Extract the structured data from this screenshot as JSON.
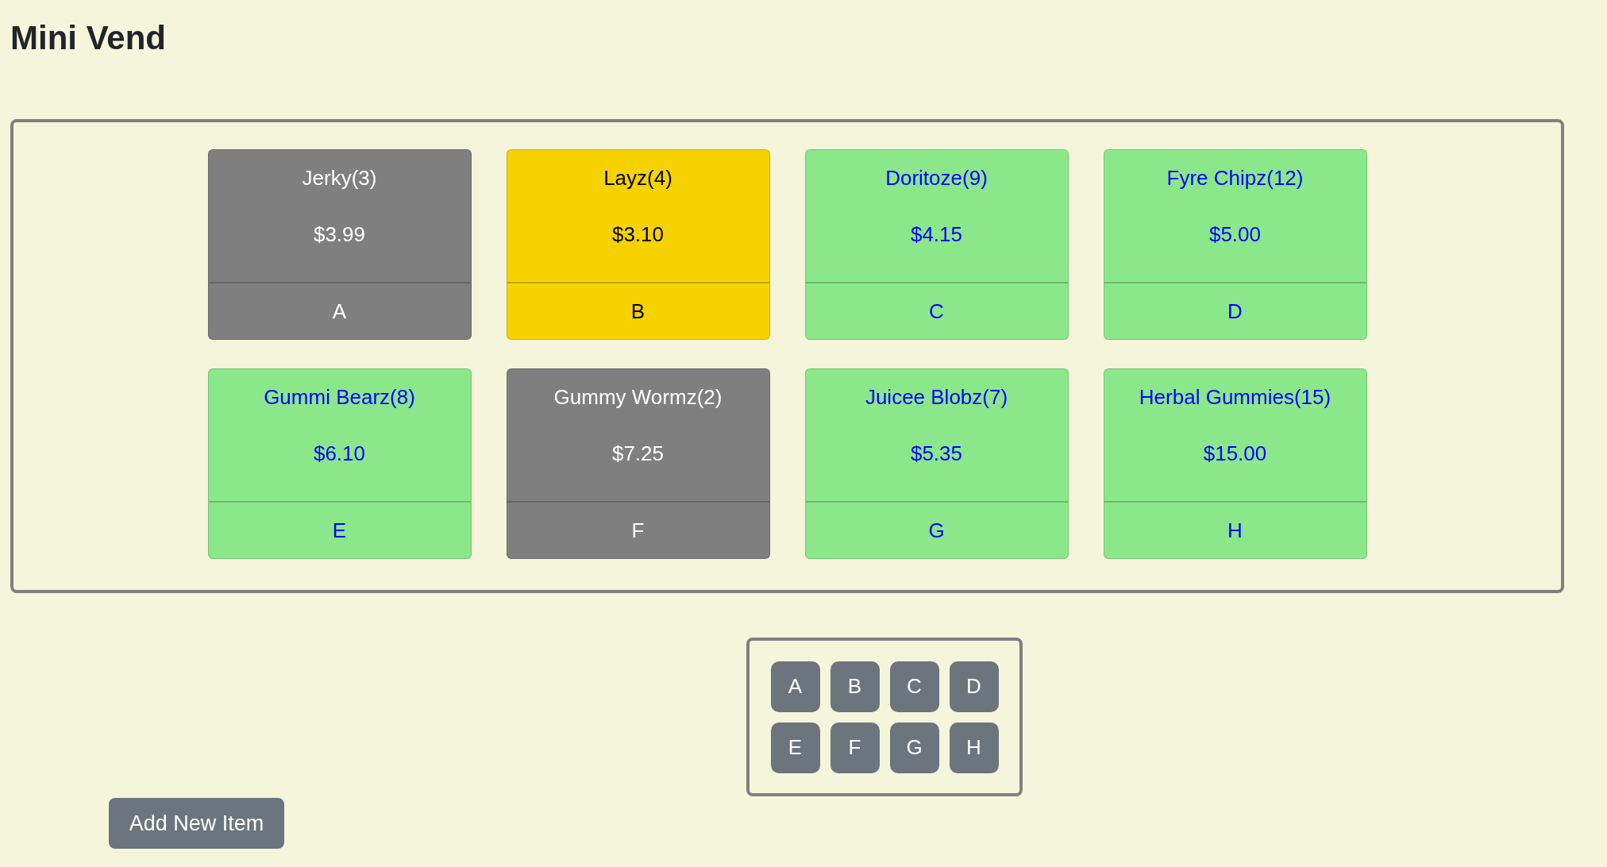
{
  "title": "Mini Vend",
  "items": [
    {
      "name": "Jerky(3)",
      "price": "$3.99",
      "slot": "A",
      "color": "#7f7f7f"
    },
    {
      "name": "Layz(4)",
      "price": "$3.10",
      "slot": "B",
      "color": "#f6d200"
    },
    {
      "name": "Doritoze(9)",
      "price": "$4.15",
      "slot": "C",
      "color": "#8ae88a"
    },
    {
      "name": "Fyre Chipz(12)",
      "price": "$5.00",
      "slot": "D",
      "color": "#8ae88a"
    },
    {
      "name": "Gummi Bearz(8)",
      "price": "$6.10",
      "slot": "E",
      "color": "#8ae88a"
    },
    {
      "name": "Gummy Wormz(2)",
      "price": "$7.25",
      "slot": "F",
      "color": "#7f7f7f"
    },
    {
      "name": "Juicee Blobz(7)",
      "price": "$5.35",
      "slot": "G",
      "color": "#8ae88a"
    },
    {
      "name": "Herbal Gummies(15)",
      "price": "$15.00",
      "slot": "H",
      "color": "#8ae88a"
    }
  ],
  "keypad": [
    "A",
    "B",
    "C",
    "D",
    "E",
    "F",
    "G",
    "H"
  ],
  "add_button": "Add New Item"
}
